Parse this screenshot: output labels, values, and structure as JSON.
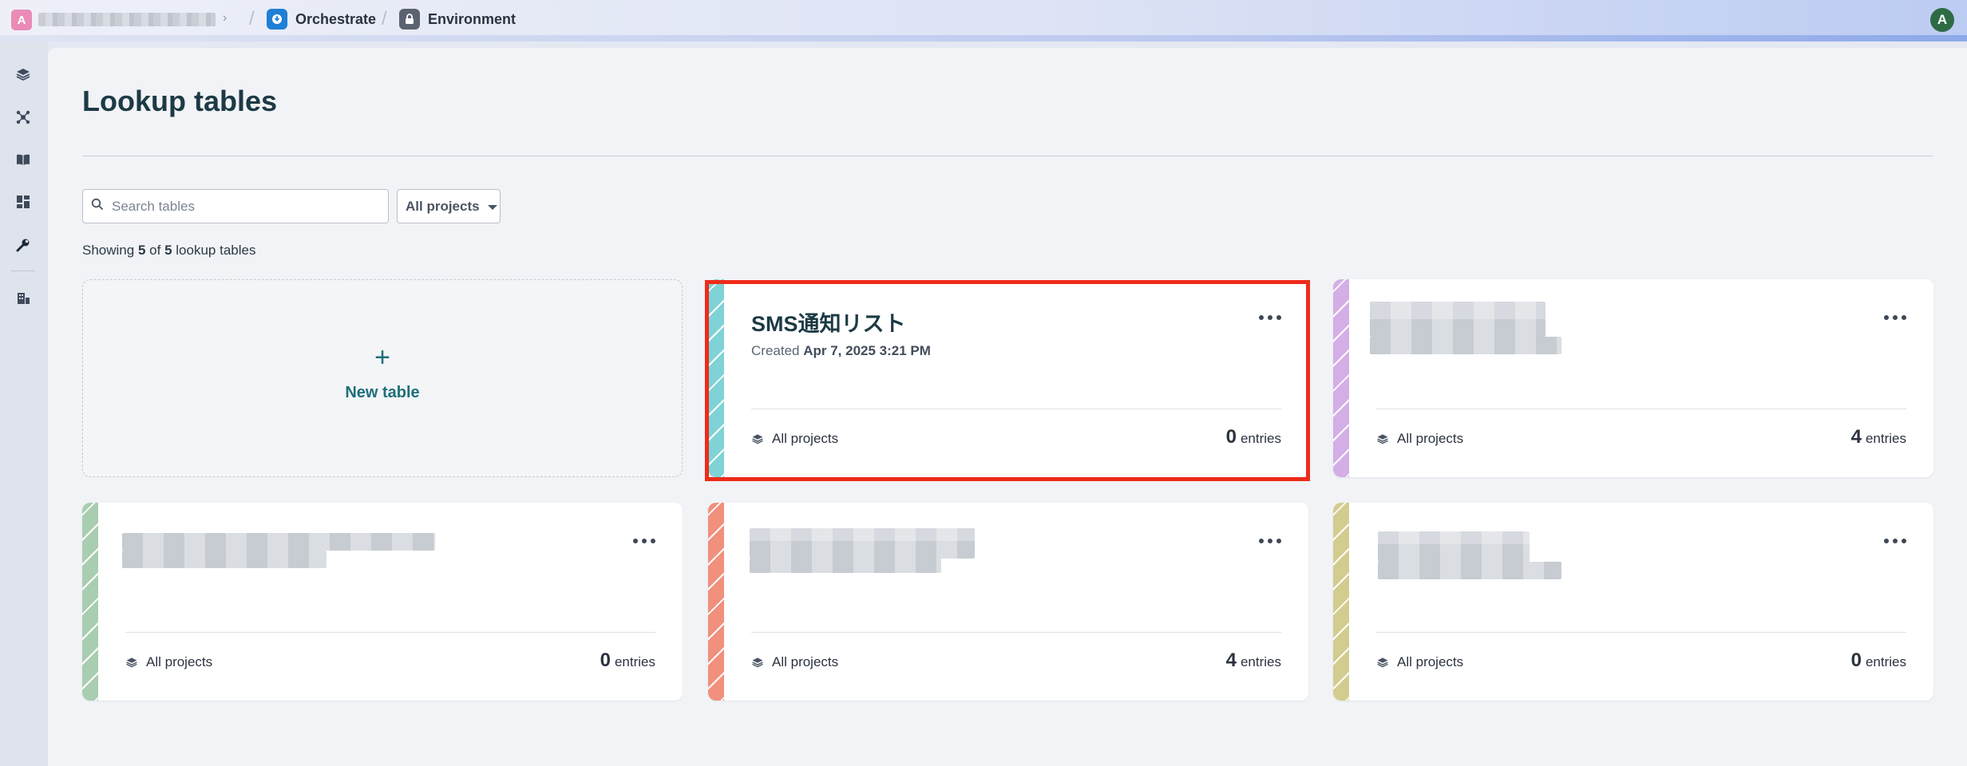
{
  "topbar": {
    "workspace_initial": "A",
    "workspace_chevron": "›",
    "separator": "/",
    "breadcrumbs": [
      {
        "label": "Orchestrate",
        "icon": "orchestrate-icon",
        "color": "#1f7fd6"
      },
      {
        "label": "Environment",
        "icon": "lock-icon",
        "color": "#5b6270"
      }
    ],
    "user_initial": "A"
  },
  "sidebar": {
    "items": [
      {
        "icon": "projects-stack-icon"
      },
      {
        "icon": "connections-icon"
      },
      {
        "icon": "docs-book-icon"
      },
      {
        "icon": "dashboard-icon"
      },
      {
        "icon": "tools-wrench-icon",
        "active": true
      },
      {
        "icon": "workspace-admin-icon"
      }
    ]
  },
  "page": {
    "title": "Lookup tables",
    "search_placeholder": "Search tables",
    "filter_label": "All projects",
    "showing_prefix": "Showing",
    "showing_count": "5",
    "showing_of": "of",
    "showing_total": "5",
    "showing_suffix": "lookup tables"
  },
  "new_table": {
    "plus": "+",
    "label": "New table"
  },
  "tables": [
    {
      "title": "SMS通知リスト",
      "created_prefix": "Created",
      "created_date": "Apr 7, 2025 3:21 PM",
      "projects": "All projects",
      "entries_count": "0",
      "entries_label": "entries",
      "color": "#7fd3d6",
      "highlighted": true
    },
    {
      "title": "",
      "projects": "All projects",
      "entries_count": "4",
      "entries_label": "entries",
      "color": "#d4aee6"
    },
    {
      "title": "",
      "projects": "All projects",
      "entries_count": "0",
      "entries_label": "entries",
      "color": "#a9cdb1"
    },
    {
      "title": "",
      "projects": "All projects",
      "entries_count": "4",
      "entries_label": "entries",
      "color": "#f0907d"
    },
    {
      "title": "",
      "projects": "All projects",
      "entries_count": "0",
      "entries_label": "entries",
      "color": "#d2cc8f"
    }
  ]
}
